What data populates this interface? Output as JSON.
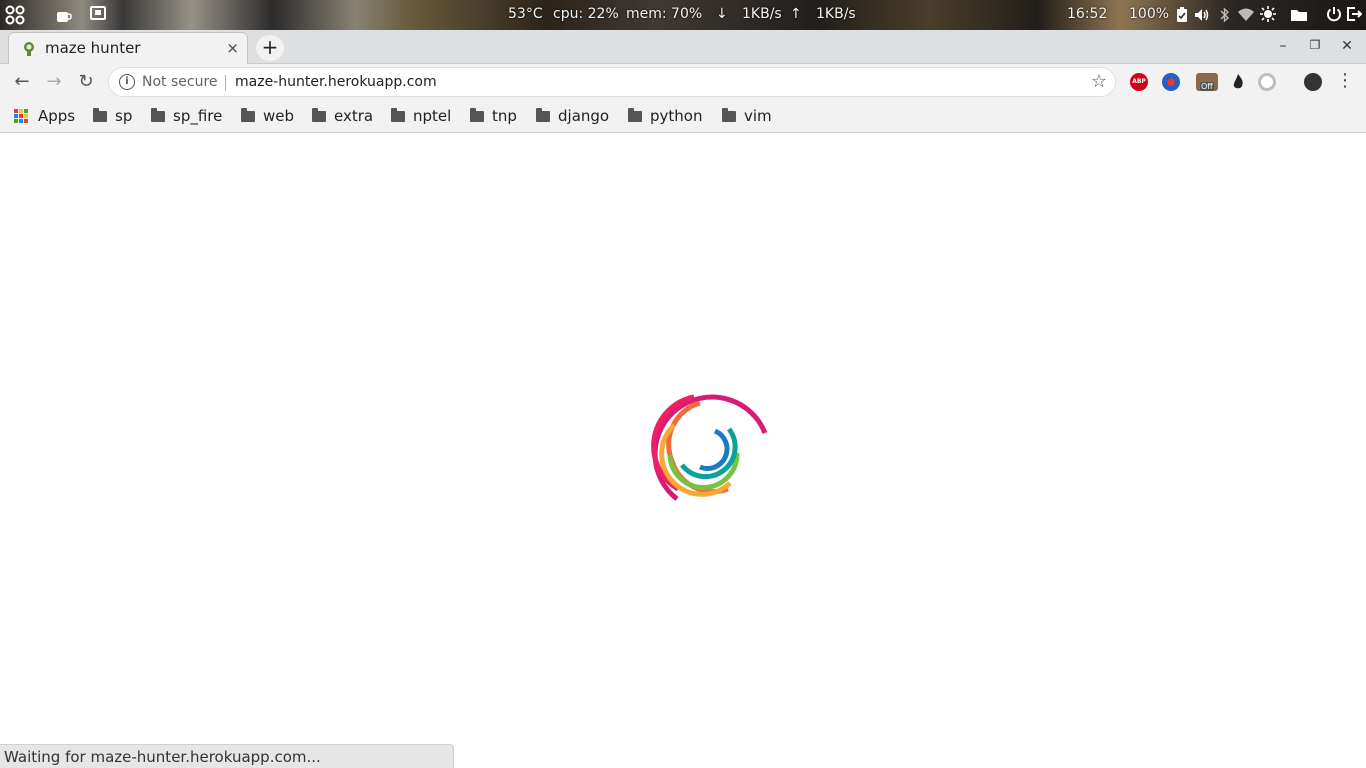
{
  "system_panel": {
    "temperature": "53°C",
    "cpu": "cpu: 22%",
    "mem": "mem: 70%",
    "down_arrow": "↓",
    "down_rate": "1KB/s",
    "up_arrow": "↑",
    "up_rate": "1KB/s",
    "clock": "16:52",
    "battery": "100%"
  },
  "tab": {
    "title": "maze hunter",
    "close_glyph": "×",
    "new_tab_glyph": "+"
  },
  "window_controls": {
    "minimize": "–",
    "restore": "❐",
    "close": "✕"
  },
  "toolbar": {
    "back_glyph": "←",
    "forward_glyph": "→",
    "reload_glyph": "↻",
    "security_label": "Not secure",
    "url": "maze-hunter.herokuapp.com",
    "star_glyph": "☆",
    "menu_glyph": "⋮"
  },
  "extensions": {
    "abp_label": "ABP",
    "off_badge": "Off"
  },
  "bookmarks": {
    "apps": "Apps",
    "items": [
      "sp",
      "sp_fire",
      "web",
      "extra",
      "nptel",
      "tnp",
      "django",
      "python",
      "vim"
    ]
  },
  "status_bar": {
    "text": "Waiting for maze-hunter.herokuapp.com..."
  },
  "colors": {
    "spinner_magenta": "#d81b74",
    "spinner_pink": "#ee1f63",
    "spinner_orange": "#f26b3a",
    "spinner_yellow": "#f7a935",
    "spinner_green": "#7ac142",
    "spinner_teal": "#0aa19b",
    "spinner_blue": "#1a7dc4"
  }
}
